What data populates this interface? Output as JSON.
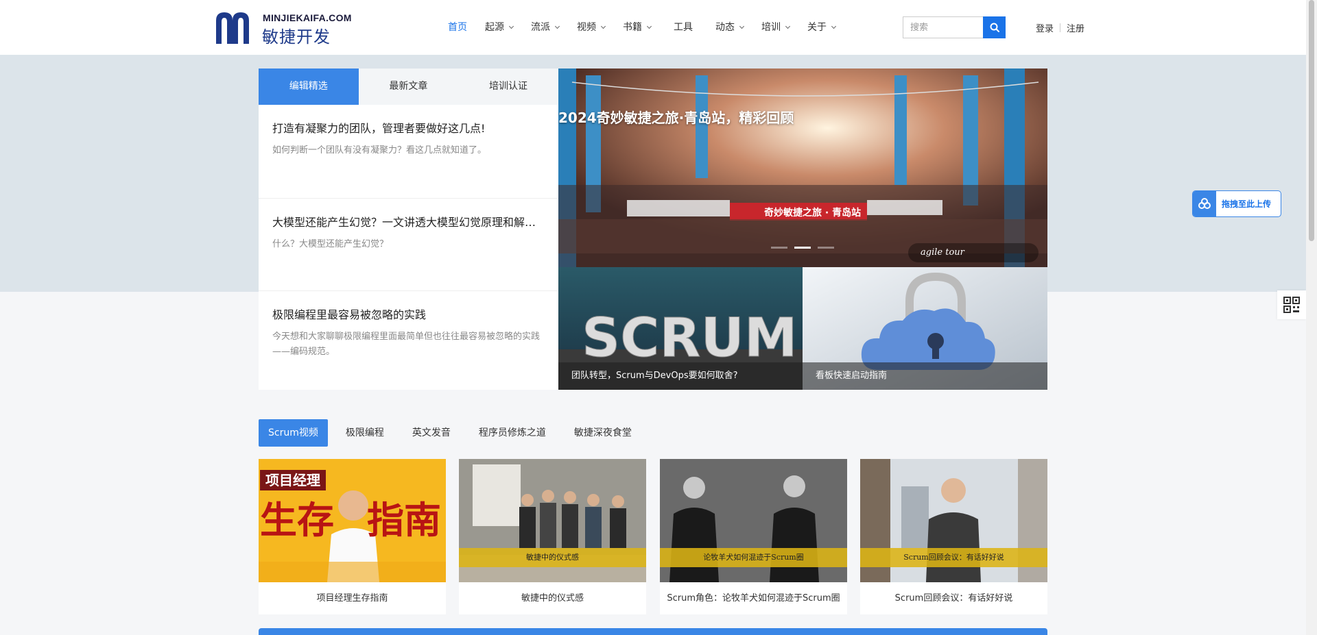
{
  "brand": {
    "domain": "MINJIEKAIFA.COM",
    "name": "敏捷开发",
    "color": "#1e3a8a"
  },
  "nav": {
    "items": [
      {
        "label": "首页",
        "active": true,
        "dropdown": false
      },
      {
        "label": "起源",
        "dropdown": true
      },
      {
        "label": "流派",
        "dropdown": true
      },
      {
        "label": "视频",
        "dropdown": true
      },
      {
        "label": "书籍",
        "dropdown": true
      },
      {
        "label": "工具",
        "dropdown": false
      },
      {
        "label": "动态",
        "dropdown": true
      },
      {
        "label": "培训",
        "dropdown": true
      },
      {
        "label": "关于",
        "dropdown": true
      }
    ]
  },
  "search": {
    "placeholder": "搜索",
    "icon": "search-icon"
  },
  "auth": {
    "login": "登录",
    "register": "注册"
  },
  "tabs": [
    {
      "label": "编辑精选",
      "active": true
    },
    {
      "label": "最新文章"
    },
    {
      "label": "培训认证"
    }
  ],
  "articles": [
    {
      "title": "打造有凝聚力的团队，管理者要做好这几点!",
      "desc": "如何判断一个团队有没有凝聚力？看这几点就知道了。"
    },
    {
      "title": "大模型还能产生幻觉？一文讲透大模型幻觉原理和解决方法",
      "desc": "什么？大模型还能产生幻觉？"
    },
    {
      "title": "极限编程里最容易被忽略的实践",
      "desc": "今天想和大家聊聊极限编程里面最简单但也往往最容易被忽略的实践——编码规范。"
    }
  ],
  "slider": {
    "title": "2024奇妙敏捷之旅·青岛站，精彩回顾",
    "banner": "奇妙敏捷之旅 · 青岛站",
    "badge": "agile tour",
    "dots": [
      false,
      true,
      false
    ]
  },
  "features": [
    {
      "caption": "团队转型，Scrum与DevOps要如何取舍?",
      "art_text": "SCRUM"
    },
    {
      "caption": "看板快速启动指南"
    }
  ],
  "categories": [
    {
      "label": "Scrum视频",
      "active": true
    },
    {
      "label": "极限编程"
    },
    {
      "label": "英文发音"
    },
    {
      "label": "程序员修炼之道"
    },
    {
      "label": "敏捷深夜食堂"
    }
  ],
  "videos": [
    {
      "title": "项目经理生存指南",
      "tag": "项目经理",
      "big1": "生存",
      "big2": "指南"
    },
    {
      "title": "敏捷中的仪式感",
      "strip": "敏捷中的仪式感"
    },
    {
      "title": "Scrum角色：论牧羊犬如何混迹于Scrum圈",
      "strip": "论牧羊犬如何混迹于Scrum圈"
    },
    {
      "title": "Scrum回顾会议：有话好好说",
      "strip": "Scrum回顾会议：有话好好说"
    }
  ],
  "floaters": {
    "upload_label": "拖拽至此上传"
  },
  "colors": {
    "accent": "#3a86e6",
    "link": "#1a73e8",
    "band": "#dce4ea"
  }
}
